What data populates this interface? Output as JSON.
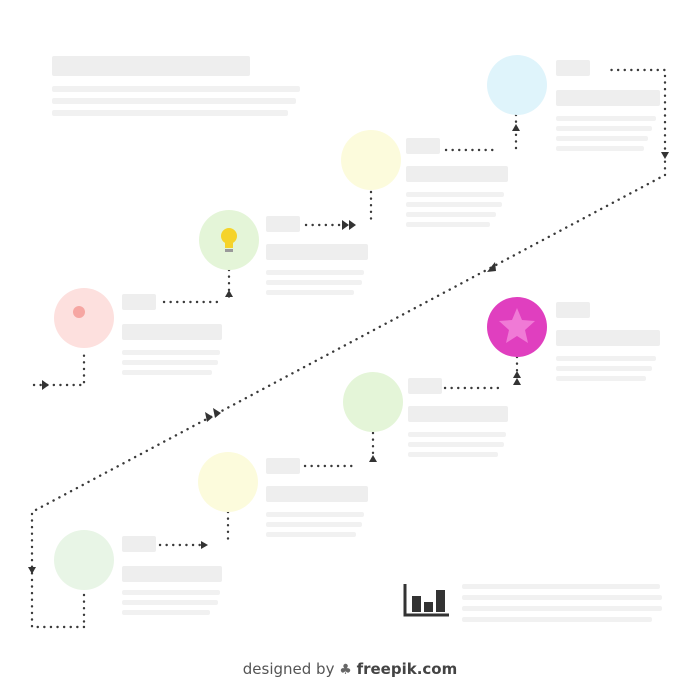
{
  "footer": {
    "designed_by": "designed by",
    "brand": "freepik.com"
  },
  "colors": {
    "step_1": "#e8f5e6",
    "step_2": "#fcfbdc",
    "step_3": "#e4f5d8",
    "step_4": "#e03fbf",
    "step_5": "#fde0de",
    "step_6": "#e4f5d8",
    "step_7": "#fcfbdc",
    "step_8": "#dff4fb",
    "connector": "#333333"
  },
  "icons": {
    "step_3_icon": "lightbulb-icon",
    "step_4_icon": "star-icon",
    "step_5_icon": "dot-icon",
    "chart_icon": "bar-chart-icon",
    "footer_icon": "freepik-hat-icon"
  }
}
